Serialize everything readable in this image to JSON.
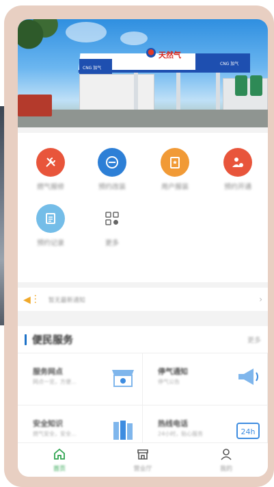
{
  "banner": {
    "brand": "天然气",
    "sign_left": "CNG 加气",
    "sign_right": "CNG 加气"
  },
  "grid": [
    {
      "label": "燃气报修",
      "icon": "wrench-screwdriver-icon",
      "color": "#e8553b"
    },
    {
      "label": "预约改装",
      "icon": "meter-icon",
      "color": "#2d7fd6"
    },
    {
      "label": "用户报装",
      "icon": "clipboard-icon",
      "color": "#f19a36"
    },
    {
      "label": "预约开通",
      "icon": "user-settings-icon",
      "color": "#e8553b"
    },
    {
      "label": "预约记录",
      "icon": "document-list-icon",
      "color": "#74bde8"
    },
    {
      "label": "更多",
      "icon": "grid-more-icon",
      "color": "#ffffff"
    }
  ],
  "notice": {
    "text": "暂无最新通知"
  },
  "services": {
    "title": "便民服务",
    "more": "更多",
    "cards": [
      {
        "title": "服务网点",
        "subtitle": "网点一览，方便...",
        "icon": "shop-location-icon"
      },
      {
        "title": "停气通知",
        "subtitle": "停气公告",
        "icon": "megaphone-icon"
      },
      {
        "title": "安全知识",
        "subtitle": "燃气安全，安全...",
        "icon": "books-icon"
      },
      {
        "title": "热线电话",
        "subtitle": "24小时，贴心服务",
        "icon": "24h-icon"
      }
    ]
  },
  "tabs": [
    {
      "label": "首页",
      "icon": "home-icon",
      "active": true
    },
    {
      "label": "营业厅",
      "icon": "store-icon",
      "active": false
    },
    {
      "label": "我的",
      "icon": "person-icon",
      "active": false
    }
  ],
  "colors": {
    "accent": "#2ea44f",
    "section_bar": "#1d72c8",
    "frame": "#e8cfc2"
  }
}
